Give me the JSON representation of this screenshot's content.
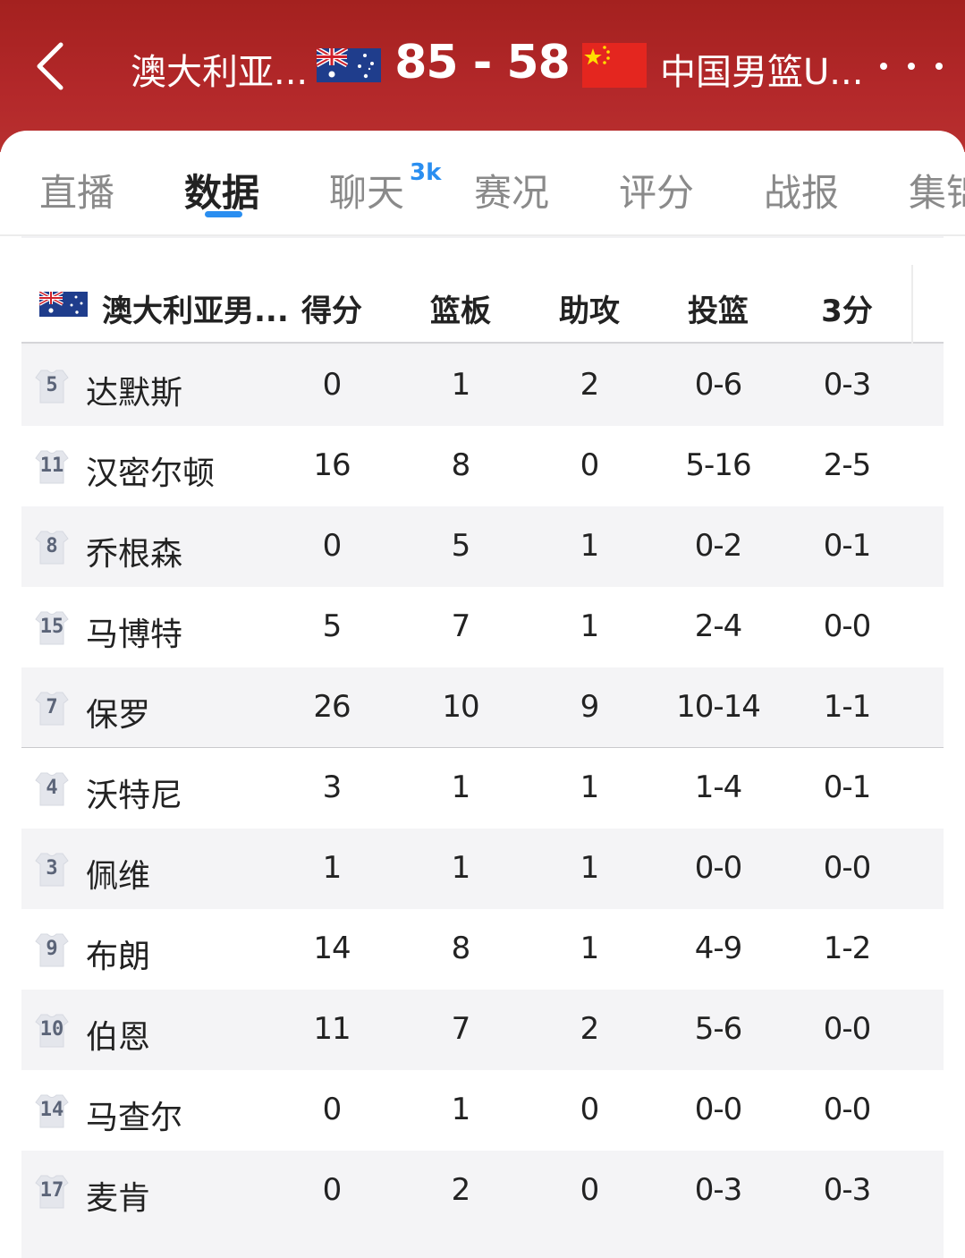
{
  "header": {
    "home_team": "澳大利亚...",
    "score": "85 - 58",
    "away_team": "中国男篮U...",
    "colors": {
      "background": "#b3282a",
      "accent": "#2a8ef0"
    }
  },
  "tabs": [
    {
      "label": "直播"
    },
    {
      "label": "数据",
      "active": true
    },
    {
      "label": "聊天",
      "badge": "3k"
    },
    {
      "label": "赛况"
    },
    {
      "label": "评分"
    },
    {
      "label": "战报"
    },
    {
      "label": "集锦"
    }
  ],
  "table": {
    "team_name": "澳大利亚男...",
    "columns": [
      "得分",
      "篮板",
      "助攻",
      "投篮",
      "3分"
    ],
    "rows": [
      {
        "number": "5",
        "name": "达默斯",
        "pts": "0",
        "reb": "1",
        "ast": "2",
        "fg": "0-6",
        "tp": "0-3"
      },
      {
        "number": "11",
        "name": "汉密尔顿",
        "pts": "16",
        "reb": "8",
        "ast": "0",
        "fg": "5-16",
        "tp": "2-5"
      },
      {
        "number": "8",
        "name": "乔根森",
        "pts": "0",
        "reb": "5",
        "ast": "1",
        "fg": "0-2",
        "tp": "0-1"
      },
      {
        "number": "15",
        "name": "马博特",
        "pts": "5",
        "reb": "7",
        "ast": "1",
        "fg": "2-4",
        "tp": "0-0"
      },
      {
        "number": "7",
        "name": "保罗",
        "pts": "26",
        "reb": "10",
        "ast": "9",
        "fg": "10-14",
        "tp": "1-1"
      },
      {
        "number": "4",
        "name": "沃特尼",
        "pts": "3",
        "reb": "1",
        "ast": "1",
        "fg": "1-4",
        "tp": "0-1"
      },
      {
        "number": "3",
        "name": "佩维",
        "pts": "1",
        "reb": "1",
        "ast": "1",
        "fg": "0-0",
        "tp": "0-0"
      },
      {
        "number": "9",
        "name": "布朗",
        "pts": "14",
        "reb": "8",
        "ast": "1",
        "fg": "4-9",
        "tp": "1-2"
      },
      {
        "number": "10",
        "name": "伯恩",
        "pts": "11",
        "reb": "7",
        "ast": "2",
        "fg": "5-6",
        "tp": "0-0"
      },
      {
        "number": "14",
        "name": "马查尔",
        "pts": "0",
        "reb": "1",
        "ast": "0",
        "fg": "0-0",
        "tp": "0-0"
      },
      {
        "number": "17",
        "name": "麦肯",
        "pts": "0",
        "reb": "2",
        "ast": "0",
        "fg": "0-3",
        "tp": "0-3"
      }
    ]
  },
  "icons": [
    "back-arrow-icon",
    "australia-flag-icon",
    "china-flag-icon",
    "more-dots-icon",
    "jersey-icon"
  ]
}
